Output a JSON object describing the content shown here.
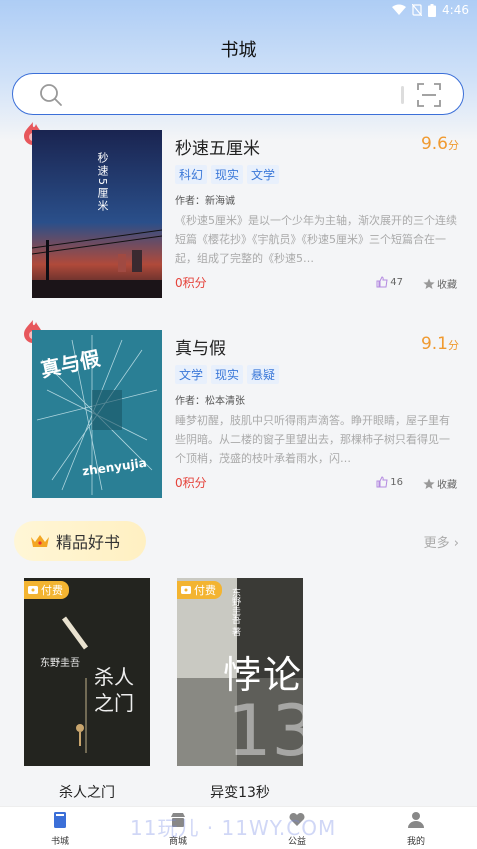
{
  "status": {
    "time": "4:46"
  },
  "header": {
    "title": "书城"
  },
  "books": [
    {
      "title": "秒速五厘米",
      "score": "9.6",
      "score_unit": "分",
      "tags": [
        "科幻",
        "现实",
        "文学"
      ],
      "author": "作者：新海诚",
      "description": "《秒速5厘米》是以一个少年为主轴，渐次展开的三个连续短篇《樱花抄》《宇航员》《秒速5厘米》三个短篇合在一起，组成了完整的《秒速5…",
      "points": "0积分",
      "likes": "47",
      "favorite": "收藏",
      "cover_text": "秒速5厘米"
    },
    {
      "title": "真与假",
      "score": "9.1",
      "score_unit": "分",
      "tags": [
        "文学",
        "现实",
        "悬疑"
      ],
      "author": "作者：松本清张",
      "description": "睡梦初醒，肢肌中只听得雨声滴答。睁开眼睛，屋子里有些阴暗。从二楼的窗子里望出去，那棵柿子树只看得见一个顶梢，茂盛的枝叶承着雨水，闪…",
      "points": "0积分",
      "likes": "16",
      "favorite": "收藏",
      "cover_text_top": "真与假",
      "cover_text_bottom": "zhenyujia"
    }
  ],
  "premium": {
    "title": "精品好书",
    "more": "更多",
    "books": [
      {
        "title": "杀人之门",
        "badge": "付费",
        "cover_author": "东野圭吾",
        "cover_title": "杀人之门"
      },
      {
        "title": "异变13秒",
        "badge": "付费",
        "cover_author": "东野圭吾 著",
        "cover_title": "悖论",
        "cover_number": "13"
      }
    ]
  },
  "tabs": [
    {
      "label": "书城",
      "icon": "book-icon"
    },
    {
      "label": "商城",
      "icon": "shop-icon"
    },
    {
      "label": "公益",
      "icon": "heart-hands-icon"
    },
    {
      "label": "我的",
      "icon": "person-icon"
    }
  ],
  "watermark": "11玩儿 · 11WY.COM"
}
